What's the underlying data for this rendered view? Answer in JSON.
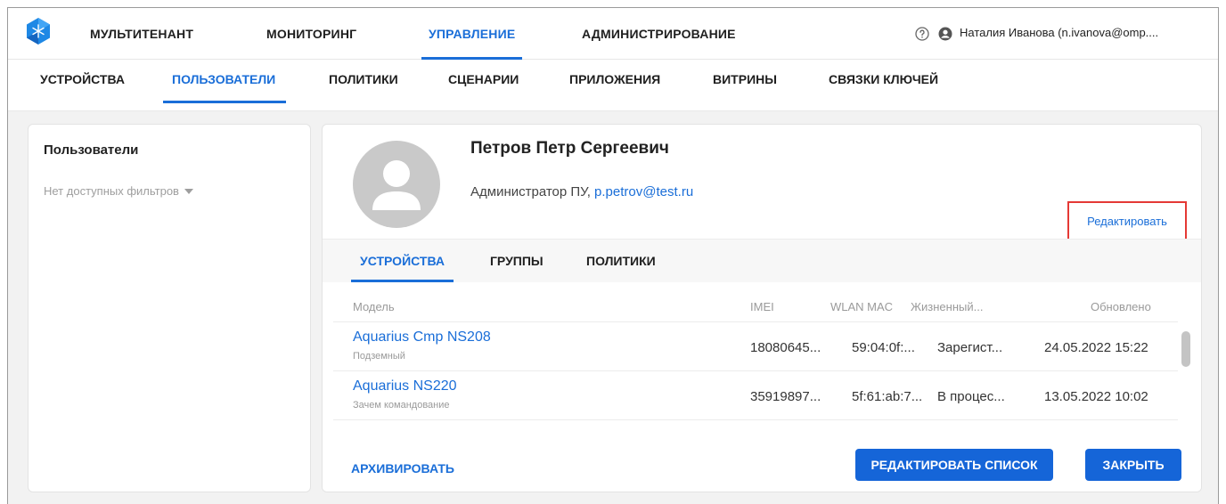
{
  "topnav": {
    "items": [
      {
        "label": "МУЛЬТИТЕНАНТ",
        "active": false
      },
      {
        "label": "МОНИТОРИНГ",
        "active": false
      },
      {
        "label": "УПРАВЛЕНИЕ",
        "active": true
      },
      {
        "label": "АДМИНИСТРИРОВАНИЕ",
        "active": false
      }
    ],
    "help_icon": "help-circle-icon",
    "user_icon": "account-circle-icon",
    "user_name": "Наталия Иванова (n.ivanova@omp...."
  },
  "subnav": {
    "items": [
      {
        "label": "УСТРОЙСТВА",
        "active": false
      },
      {
        "label": "ПОЛЬЗОВАТЕЛИ",
        "active": true
      },
      {
        "label": "ПОЛИТИКИ",
        "active": false
      },
      {
        "label": "СЦЕНАРИИ",
        "active": false
      },
      {
        "label": "ПРИЛОЖЕНИЯ",
        "active": false
      },
      {
        "label": "ВИТРИНЫ",
        "active": false
      },
      {
        "label": "СВЯЗКИ КЛЮЧЕЙ",
        "active": false
      }
    ]
  },
  "sidebar": {
    "title": "Пользователи",
    "filter_label": "Нет доступных фильтров"
  },
  "profile": {
    "name": "Петров Петр Сергеевич",
    "role": "Администратор ПУ, ",
    "email": "p.petrov@test.ru",
    "edit_label": "Редактировать"
  },
  "tabs": [
    {
      "label": "УСТРОЙСТВА",
      "active": true
    },
    {
      "label": "ГРУППЫ",
      "active": false
    },
    {
      "label": "ПОЛИТИКИ",
      "active": false
    }
  ],
  "table": {
    "columns": [
      "Модель",
      "IMEI",
      "WLAN MAC",
      "Жизненный...",
      "Обновлено"
    ],
    "rows": [
      {
        "model": "Aquarius Cmp NS208",
        "sub": "Подземный",
        "imei": "18080645...",
        "mac": "59:04:0f:...",
        "lifecycle": "Зарегист...",
        "updated": "24.05.2022 15:22"
      },
      {
        "model": "Aquarius NS220",
        "sub": "Зачем командование",
        "imei": "35919897...",
        "mac": "5f:61:ab:7...",
        "lifecycle": "В процес...",
        "updated": "13.05.2022 10:02"
      }
    ]
  },
  "footer": {
    "archive_label": "АРХИВИРОВАТЬ",
    "edit_list_label": "РЕДАКТИРОВАТЬ СПИСОК",
    "close_label": "ЗАКРЫТЬ"
  },
  "colors": {
    "accent": "#1a6ed8",
    "button": "#1565d8",
    "highlight": "#e53935"
  }
}
